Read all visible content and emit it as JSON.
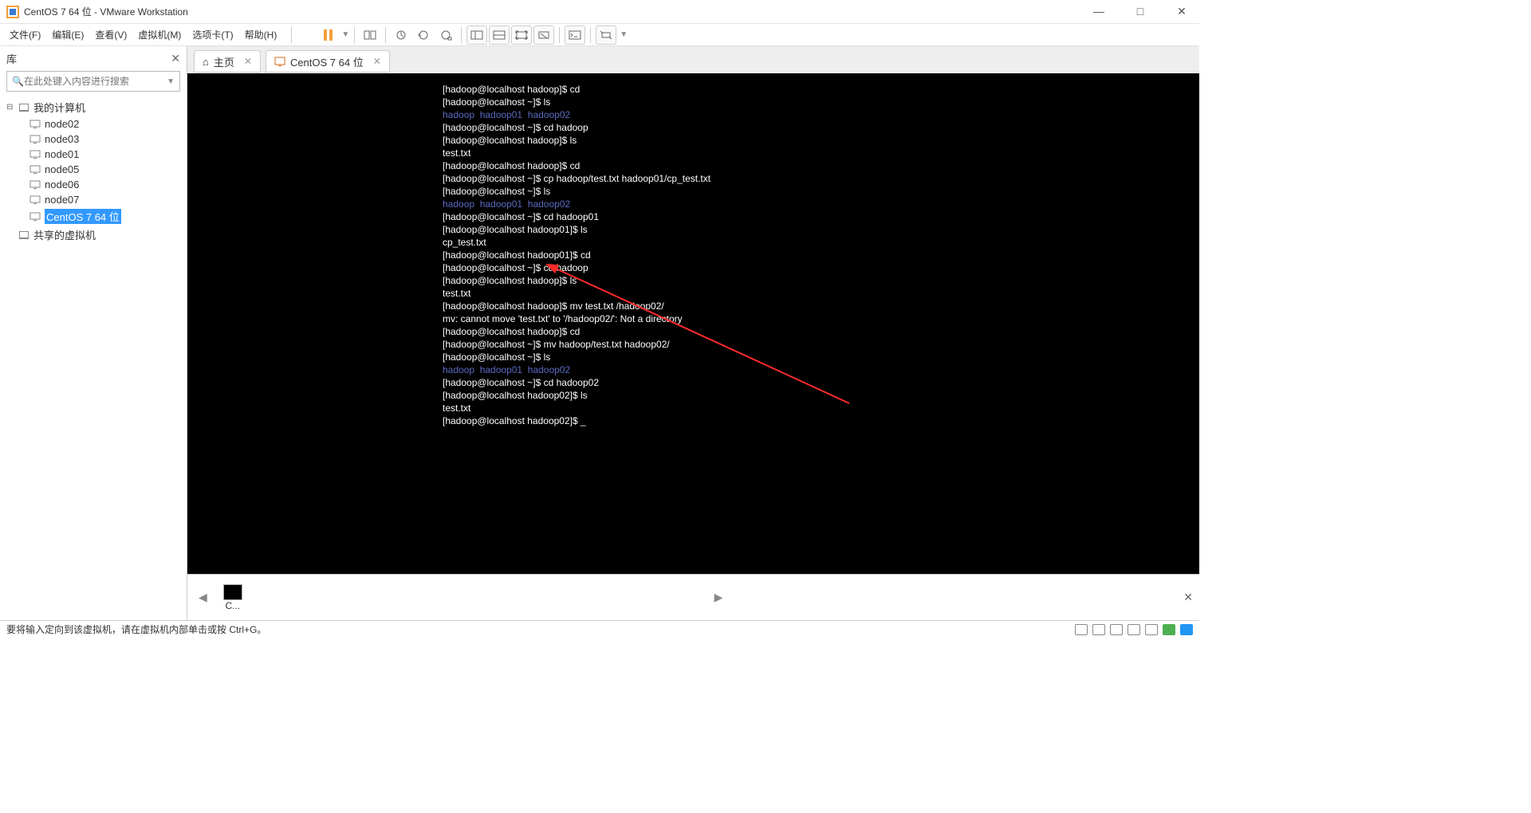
{
  "window": {
    "title": "CentOS 7 64 位 - VMware Workstation"
  },
  "menu": {
    "file": "文件(F)",
    "edit": "编辑(E)",
    "view": "查看(V)",
    "vm": "虚拟机(M)",
    "tabs": "选项卡(T)",
    "help": "帮助(H)"
  },
  "sidebar": {
    "title": "库",
    "search_placeholder": "在此处键入内容进行搜索",
    "root": "我的计算机",
    "nodes": [
      {
        "label": "node02"
      },
      {
        "label": "node03"
      },
      {
        "label": "node01"
      },
      {
        "label": "node05"
      },
      {
        "label": "node06"
      },
      {
        "label": "node07"
      },
      {
        "label": "CentOS 7 64 位",
        "selected": true
      }
    ],
    "shared": "共享的虚拟机"
  },
  "tabs": {
    "home": "主页",
    "active": "CentOS 7 64 位"
  },
  "terminal": {
    "lines": [
      {
        "t": "[hadoop@localhost hadoop]$ cd"
      },
      {
        "t": "[hadoop@localhost ~]$ ls"
      },
      {
        "t": "hadoop  hadoop01  hadoop02",
        "c": "dir"
      },
      {
        "t": "[hadoop@localhost ~]$ cd hadoop"
      },
      {
        "t": "[hadoop@localhost hadoop]$ ls"
      },
      {
        "t": "test.txt"
      },
      {
        "t": "[hadoop@localhost hadoop]$ cd"
      },
      {
        "t": "[hadoop@localhost ~]$ cp hadoop/test.txt hadoop01/cp_test.txt"
      },
      {
        "t": "[hadoop@localhost ~]$ ls"
      },
      {
        "t": "hadoop  hadoop01  hadoop02",
        "c": "dir"
      },
      {
        "t": "[hadoop@localhost ~]$ cd hadoop01"
      },
      {
        "t": "[hadoop@localhost hadoop01]$ ls"
      },
      {
        "t": "cp_test.txt"
      },
      {
        "t": "[hadoop@localhost hadoop01]$ cd"
      },
      {
        "t": "[hadoop@localhost ~]$ cd hadoop"
      },
      {
        "t": "[hadoop@localhost hadoop]$ ls"
      },
      {
        "t": "test.txt"
      },
      {
        "t": "[hadoop@localhost hadoop]$ mv test.txt /hadoop02/"
      },
      {
        "t": "mv: cannot move 'test.txt' to '/hadoop02/': Not a directory"
      },
      {
        "t": "[hadoop@localhost hadoop]$ cd"
      },
      {
        "t": "[hadoop@localhost ~]$ mv hadoop/test.txt hadoop02/"
      },
      {
        "t": "[hadoop@localhost ~]$ ls"
      },
      {
        "t": "hadoop  hadoop01  hadoop02",
        "c": "dir"
      },
      {
        "t": "[hadoop@localhost ~]$ cd hadoop02"
      },
      {
        "t": "[hadoop@localhost hadoop02]$ ls"
      },
      {
        "t": "test.txt"
      },
      {
        "t": "[hadoop@localhost hadoop02]$ _"
      }
    ]
  },
  "thumbstrip": {
    "label": "C..."
  },
  "statusbar": {
    "text": "要将输入定向到该虚拟机，请在虚拟机内部单击或按 Ctrl+G。"
  }
}
